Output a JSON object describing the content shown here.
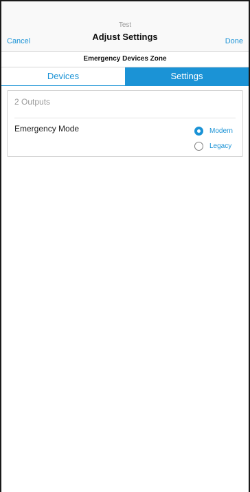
{
  "nav": {
    "subtitle": "Test",
    "title": "Adjust Settings",
    "cancel_label": "Cancel",
    "done_label": "Done"
  },
  "zone": {
    "name": "Emergency Devices Zone"
  },
  "tabs": [
    {
      "label": "Devices",
      "active": false
    },
    {
      "label": "Settings",
      "active": true
    }
  ],
  "settings": {
    "outputs_label": "2 Outputs",
    "emergency_mode": {
      "label": "Emergency Mode",
      "options": [
        {
          "label": "Modern",
          "selected": true
        },
        {
          "label": "Legacy",
          "selected": false
        }
      ]
    }
  },
  "colors": {
    "accent": "#1b93d6"
  }
}
